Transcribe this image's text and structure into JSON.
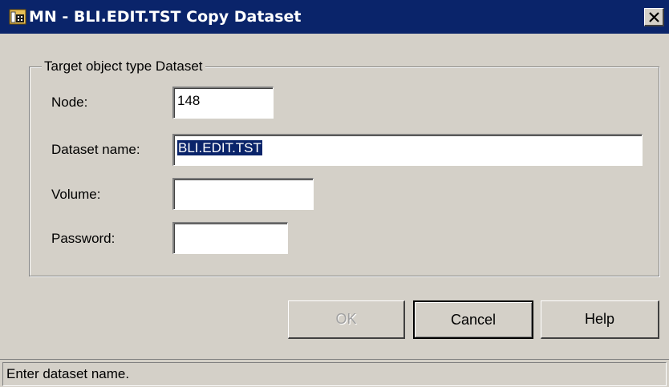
{
  "window": {
    "title": "MN - BLI.EDIT.TST Copy Dataset",
    "icon": "dataset-window-icon",
    "close_icon": "close-icon"
  },
  "group": {
    "legend": "Target object type Dataset"
  },
  "fields": {
    "node": {
      "label": "Node:",
      "value": "148"
    },
    "dataset_name": {
      "label": "Dataset name:",
      "value": "BLI.EDIT.TST"
    },
    "volume": {
      "label": "Volume:",
      "value": ""
    },
    "password": {
      "label": "Password:",
      "value": ""
    }
  },
  "buttons": {
    "ok": "OK",
    "cancel": "Cancel",
    "help": "Help"
  },
  "status": {
    "text": "Enter dataset name."
  },
  "colors": {
    "titlebar": "#0a246a",
    "face": "#d4d0c8",
    "selection": "#0a246a"
  }
}
